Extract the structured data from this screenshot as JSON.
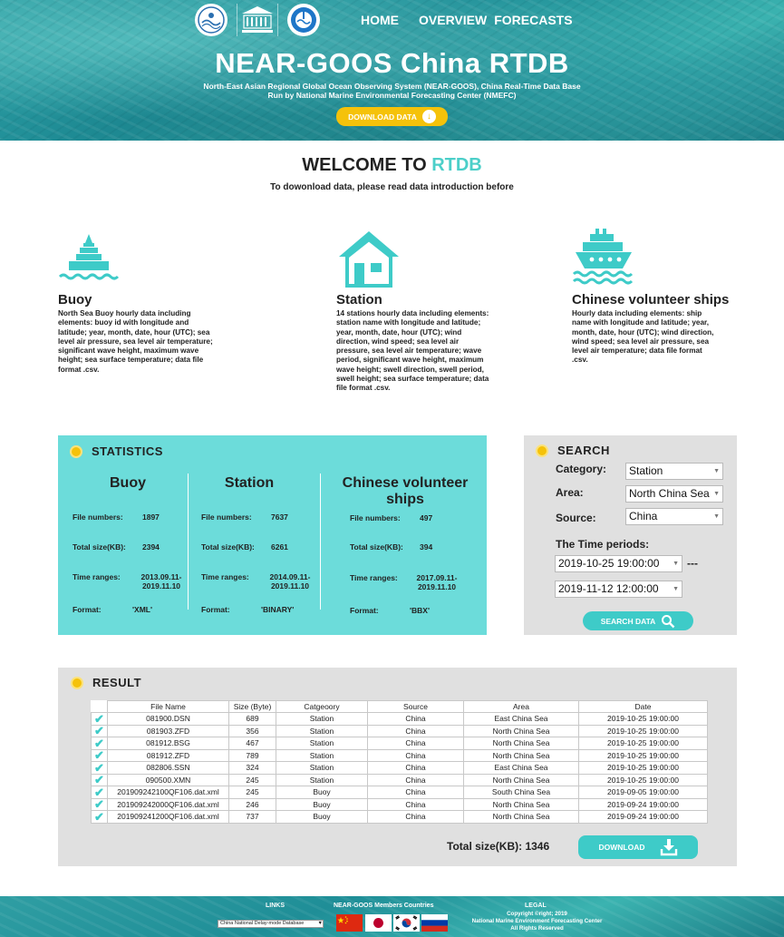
{
  "header": {
    "nav": [
      "HOME",
      "OVERVIEW",
      "FORECASTS"
    ],
    "title": "NEAR-GOOS China RTDB",
    "subtitle_line1": "North-East Asian Regional Global Ocean Observing System (NEAR-GOOS), China Real-Time Data Base",
    "subtitle_line2": "Run by National Marine Environmental Forecasting Center (NMEFC)",
    "download_label": "DOWNLOAD DATA",
    "logos": [
      "noc-logo",
      "unesco-logo",
      "ioc-logo"
    ]
  },
  "welcome": {
    "title_main": "WELCOME TO ",
    "title_accent": "RTDB",
    "subtitle": "To dowonload data, please read data introduction before"
  },
  "features": [
    {
      "title": "Buoy",
      "icon": "buoy-icon",
      "desc": "North Sea Buoy hourly data including elements: buoy id with longitude and latitude; year, month, date, hour (UTC); sea level air pressure, sea level air temperature; significant wave height, maximum wave height; sea surface temperature; data file format .csv."
    },
    {
      "title": "Station",
      "icon": "house-icon",
      "desc": "14 stations hourly data including elements: station name with longitude and latitude; year, month, date, hour (UTC); wind direction, wind speed; sea level air pressure, sea level air temperature; wave period, significant wave height, maximum wave height; swell direction, swell period, swell height; sea surface temperature; data file format .csv."
    },
    {
      "title": "Chinese volunteer ships",
      "icon": "ship-icon",
      "desc": "Hourly data including elements: ship name with longitude and latitude; year, month, date, hour (UTC); wind direction, wind speed; sea level air pressure, sea level air temperature; data file format .csv."
    }
  ],
  "statistics": {
    "heading": "STATISTICS",
    "labels": {
      "file_numbers": "File numbers:",
      "total_size": "Total size(KB):",
      "time_ranges": "Time ranges:",
      "format": "Format:"
    },
    "columns": [
      {
        "title": "Buoy",
        "file_numbers": "1897",
        "total_size": "2394",
        "time_range_1": "2013.09.11-",
        "time_range_2": "2019.11.10",
        "format": "'XML'"
      },
      {
        "title": "Station",
        "file_numbers": "7637",
        "total_size": "6261",
        "time_range_1": "2014.09.11-",
        "time_range_2": "2019.11.10",
        "format": "'BINARY'"
      },
      {
        "title_1": "Chinese volunteer",
        "title_2": "ships",
        "file_numbers": "497",
        "total_size": "394",
        "time_range_1": "2017.09.11-",
        "time_range_2": "2019.11.10",
        "format": "'BBX'"
      }
    ]
  },
  "search": {
    "heading": "SEARCH",
    "category_label": "Category:",
    "category_value": "Station",
    "area_label": "Area:",
    "area_value": "North China Sea",
    "source_label": "Source:",
    "source_value": "China",
    "time_label": "The Time periods:",
    "time_start": "2019-10-25 19:00:00",
    "time_sep": "---",
    "time_end": "2019-11-12 12:00:00",
    "button_label": "SEARCH DATA"
  },
  "result": {
    "heading": "RESULT",
    "columns": [
      "File Name",
      "Size (Byte)",
      "Catgeoory",
      "Source",
      "Area",
      "Date"
    ],
    "rows": [
      [
        "081900.DSN",
        "689",
        "Station",
        "China",
        "East China Sea",
        "2019-10-25 19:00:00"
      ],
      [
        "081903.ZFD",
        "356",
        "Station",
        "China",
        "North China Sea",
        "2019-10-25 19:00:00"
      ],
      [
        "081912.BSG",
        "467",
        "Station",
        "China",
        "North China Sea",
        "2019-10-25 19:00:00"
      ],
      [
        "081912.ZFD",
        "789",
        "Station",
        "China",
        "North China Sea",
        "2019-10-25 19:00:00"
      ],
      [
        "082806.SSN",
        "324",
        "Station",
        "China",
        "East China Sea",
        "2019-10-25 19:00:00"
      ],
      [
        "090500.XMN",
        "245",
        "Station",
        "China",
        "North China Sea",
        "2019-10-25 19:00:00"
      ],
      [
        "201909242100QF106.dat.xml",
        "245",
        "Buoy",
        "China",
        "South China Sea",
        "2019-09-05 19:00:00"
      ],
      [
        "201909242000QF106.dat.xml",
        "246",
        "Buoy",
        "China",
        "North China Sea",
        "2019-09-24 19:00:00"
      ],
      [
        "201909241200QF106.dat.xml",
        "737",
        "Buoy",
        "China",
        "North China Sea",
        "2019-09-24 19:00:00"
      ]
    ],
    "total_label": "Total size(KB): 1346",
    "download_label": "DOWNLOAD"
  },
  "footer": {
    "links_heading": "LINKS",
    "links_select": "China National Delay-mode Database",
    "members_heading": "NEAR-GOOS Members Countries",
    "flags": [
      "china-flag",
      "japan-flag",
      "korea-flag",
      "russia-flag"
    ],
    "legal_heading": "LEGAL",
    "legal_line1": "Copyright ©right; 2019",
    "legal_line2": "National Marine Environment Forecasting Center",
    "legal_line3": "All Rights Reserved"
  },
  "colors": {
    "accent": "#4ccfc9",
    "panel": "#6cdcda",
    "button": "#3ecbc8",
    "yellow": "#f5c20a",
    "grey_panel": "#e0e0e0"
  }
}
